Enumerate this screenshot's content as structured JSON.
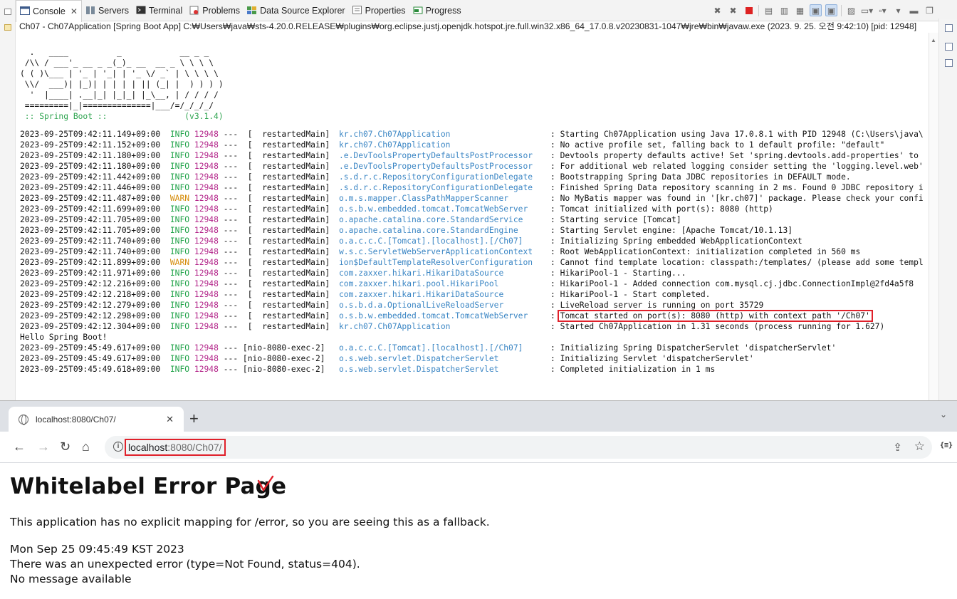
{
  "eclipse": {
    "tabs": [
      {
        "label": "Console",
        "icon": "console-icon",
        "active": true
      },
      {
        "label": "Servers",
        "icon": "servers-icon"
      },
      {
        "label": "Terminal",
        "icon": "terminal-icon"
      },
      {
        "label": "Problems",
        "icon": "problems-icon"
      },
      {
        "label": "Data Source Explorer",
        "icon": "data-source-icon"
      },
      {
        "label": "Properties",
        "icon": "properties-icon"
      },
      {
        "label": "Progress",
        "icon": "progress-icon"
      }
    ],
    "console_description": "Ch07 - Ch07Application [Spring Boot App] C:₩Users₩java₩sts-4.20.0.RELEASE₩plugins₩org.eclipse.justj.openjdk.hotspot.jre.full.win32.x86_64_17.0.8.v20230831-1047₩jre₩bin₩javaw.exe  (2023. 9. 25. 오전 9:42:10) [pid: 12948]",
    "banner": [
      "  .   ____          _            __ _ _",
      " /\\\\ / ___'_ __ _ _(_)_ __  __ _ \\ \\ \\ \\",
      "( ( )\\___ | '_ | '_| | '_ \\/ _` | \\ \\ \\ \\",
      " \\\\/  ___)| |_)| | | | | || (_| |  ) ) ) )",
      "  '  |____| .__|_| |_|_| |_\\__, | / / / /",
      " =========|_|==============|___/=/_/_/_/"
    ],
    "spring_boot_line": " :: Spring Boot ::                (v3.1.4)",
    "log": [
      {
        "ts": "2023-09-25T09:42:11.149+09:00",
        "level": "INFO",
        "pid": "12948",
        "thread": "---  [  restartedMain]",
        "logger": "kr.ch07.Ch07Application",
        "msg": ": Starting Ch07Application using Java 17.0.8.1 with PID 12948 (C:\\Users\\java\\"
      },
      {
        "ts": "2023-09-25T09:42:11.152+09:00",
        "level": "INFO",
        "pid": "12948",
        "thread": "---  [  restartedMain]",
        "logger": "kr.ch07.Ch07Application",
        "msg": ": No active profile set, falling back to 1 default profile: \"default\""
      },
      {
        "ts": "2023-09-25T09:42:11.180+09:00",
        "level": "INFO",
        "pid": "12948",
        "thread": "---  [  restartedMain]",
        "logger": ".e.DevToolsPropertyDefaultsPostProcessor",
        "msg": ": Devtools property defaults active! Set 'spring.devtools.add-properties' to"
      },
      {
        "ts": "2023-09-25T09:42:11.180+09:00",
        "level": "INFO",
        "pid": "12948",
        "thread": "---  [  restartedMain]",
        "logger": ".e.DevToolsPropertyDefaultsPostProcessor",
        "msg": ": For additional web related logging consider setting the 'logging.level.web'"
      },
      {
        "ts": "2023-09-25T09:42:11.442+09:00",
        "level": "INFO",
        "pid": "12948",
        "thread": "---  [  restartedMain]",
        "logger": ".s.d.r.c.RepositoryConfigurationDelegate",
        "msg": ": Bootstrapping Spring Data JDBC repositories in DEFAULT mode."
      },
      {
        "ts": "2023-09-25T09:42:11.446+09:00",
        "level": "INFO",
        "pid": "12948",
        "thread": "---  [  restartedMain]",
        "logger": ".s.d.r.c.RepositoryConfigurationDelegate",
        "msg": ": Finished Spring Data repository scanning in 2 ms. Found 0 JDBC repository i"
      },
      {
        "ts": "2023-09-25T09:42:11.487+09:00",
        "level": "WARN",
        "pid": "12948",
        "thread": "---  [  restartedMain]",
        "logger": "o.m.s.mapper.ClassPathMapperScanner",
        "msg": ": No MyBatis mapper was found in '[kr.ch07]' package. Please check your confi"
      },
      {
        "ts": "2023-09-25T09:42:11.699+09:00",
        "level": "INFO",
        "pid": "12948",
        "thread": "---  [  restartedMain]",
        "logger": "o.s.b.w.embedded.tomcat.TomcatWebServer",
        "msg": ": Tomcat initialized with port(s): 8080 (http)"
      },
      {
        "ts": "2023-09-25T09:42:11.705+09:00",
        "level": "INFO",
        "pid": "12948",
        "thread": "---  [  restartedMain]",
        "logger": "o.apache.catalina.core.StandardService",
        "msg": ": Starting service [Tomcat]"
      },
      {
        "ts": "2023-09-25T09:42:11.705+09:00",
        "level": "INFO",
        "pid": "12948",
        "thread": "---  [  restartedMain]",
        "logger": "o.apache.catalina.core.StandardEngine",
        "msg": ": Starting Servlet engine: [Apache Tomcat/10.1.13]"
      },
      {
        "ts": "2023-09-25T09:42:11.740+09:00",
        "level": "INFO",
        "pid": "12948",
        "thread": "---  [  restartedMain]",
        "logger": "o.a.c.c.C.[Tomcat].[localhost].[/Ch07]",
        "msg": ": Initializing Spring embedded WebApplicationContext"
      },
      {
        "ts": "2023-09-25T09:42:11.740+09:00",
        "level": "INFO",
        "pid": "12948",
        "thread": "---  [  restartedMain]",
        "logger": "w.s.c.ServletWebServerApplicationContext",
        "msg": ": Root WebApplicationContext: initialization completed in 560 ms"
      },
      {
        "ts": "2023-09-25T09:42:11.899+09:00",
        "level": "WARN",
        "pid": "12948",
        "thread": "---  [  restartedMain]",
        "logger": "ion$DefaultTemplateResolverConfiguration",
        "msg": ": Cannot find template location: classpath:/templates/ (please add some templ"
      },
      {
        "ts": "2023-09-25T09:42:11.971+09:00",
        "level": "INFO",
        "pid": "12948",
        "thread": "---  [  restartedMain]",
        "logger": "com.zaxxer.hikari.HikariDataSource",
        "msg": ": HikariPool-1 - Starting..."
      },
      {
        "ts": "2023-09-25T09:42:12.216+09:00",
        "level": "INFO",
        "pid": "12948",
        "thread": "---  [  restartedMain]",
        "logger": "com.zaxxer.hikari.pool.HikariPool",
        "msg": ": HikariPool-1 - Added connection com.mysql.cj.jdbc.ConnectionImpl@2fd4a5f8"
      },
      {
        "ts": "2023-09-25T09:42:12.218+09:00",
        "level": "INFO",
        "pid": "12948",
        "thread": "---  [  restartedMain]",
        "logger": "com.zaxxer.hikari.HikariDataSource",
        "msg": ": HikariPool-1 - Start completed."
      },
      {
        "ts": "2023-09-25T09:42:12.279+09:00",
        "level": "INFO",
        "pid": "12948",
        "thread": "---  [  restartedMain]",
        "logger": "o.s.b.d.a.OptionalLiveReloadServer",
        "msg": ": LiveReload server is running on port 35729"
      },
      {
        "ts": "2023-09-25T09:42:12.298+09:00",
        "level": "INFO",
        "pid": "12948",
        "thread": "---  [  restartedMain]",
        "logger": "o.s.b.w.embedded.tomcat.TomcatWebServer",
        "msg_prefix": ": ",
        "msg": "Tomcat started on port(s): 8080 (http) with context path '/Ch07'",
        "highlight": true
      },
      {
        "ts": "2023-09-25T09:42:12.304+09:00",
        "level": "INFO",
        "pid": "12948",
        "thread": "---  [  restartedMain]",
        "logger": "kr.ch07.Ch07Application",
        "msg": ": Started Ch07Application in 1.31 seconds (process running for 1.627)"
      },
      {
        "plain": "Hello Spring Boot!"
      },
      {
        "ts": "2023-09-25T09:45:49.617+09:00",
        "level": "INFO",
        "pid": "12948",
        "thread": "--- [nio-8080-exec-2]",
        "logger": "o.a.c.c.C.[Tomcat].[localhost].[/Ch07]",
        "msg": ": Initializing Spring DispatcherServlet 'dispatcherServlet'"
      },
      {
        "ts": "2023-09-25T09:45:49.617+09:00",
        "level": "INFO",
        "pid": "12948",
        "thread": "--- [nio-8080-exec-2]",
        "logger": "o.s.web.servlet.DispatcherServlet",
        "msg": ": Initializing Servlet 'dispatcherServlet'"
      },
      {
        "ts": "2023-09-25T09:45:49.618+09:00",
        "level": "INFO",
        "pid": "12948",
        "thread": "--- [nio-8080-exec-2]",
        "logger": "o.s.web.servlet.DispatcherServlet",
        "msg": ": Completed initialization in 1 ms"
      }
    ]
  },
  "browser": {
    "tab_title": "localhost:8080/Ch07/",
    "new_tab": "+",
    "url_host": "localhost",
    "url_rest": ":8080/Ch07/",
    "page": {
      "title": "Whitelabel Error Page",
      "description": "This application has no explicit mapping for /error, so you are seeing this as a fallback.",
      "timestamp": "Mon Sep 25 09:45:49 KST 2023",
      "error": "There was an unexpected error (type=Not Found, status=404).",
      "message": "No message available"
    }
  },
  "colors": {
    "highlight": "#e0202a",
    "info": "#22a34a",
    "warn": "#d58c0a",
    "pid": "#b3268a",
    "logger": "#3b86c4"
  }
}
